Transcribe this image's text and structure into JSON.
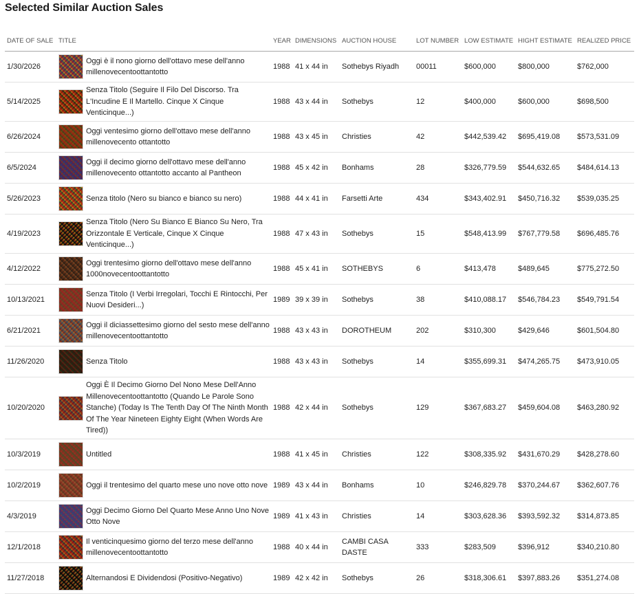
{
  "page": {
    "title": "Selected Similar Auction Sales"
  },
  "table": {
    "headers": {
      "date": "DATE OF SALE",
      "title": "TITLE",
      "year": "YEAR",
      "dimensions": "DIMENSIONS",
      "house": "AUCTION HOUSE",
      "lot": "LOT NUMBER",
      "low": "LOW ESTIMATE",
      "high": "HIGHT ESTIMATE",
      "realized": "REALIZED PRICE"
    },
    "rows": [
      {
        "date": "1/30/2026",
        "title": "Oggi è il nono giorno dell'ottavo mese dell'anno millenovecentoottantotto",
        "year": "1988",
        "dimensions": "41 x 44 in",
        "house": "Sothebys Riyadh",
        "lot": "00011",
        "low": "$600,000",
        "high": "$800,000",
        "realized": "$762,000",
        "thumb_colors": [
          "#b0567d",
          "#5b8fb3",
          "#d6b25a"
        ]
      },
      {
        "date": "5/14/2025",
        "title": "Senza Titolo (Seguire Il Filo Del Discorso. Tra L'Incudine E Il Martello. Cinque X Cinque Venticinque...)",
        "year": "1988",
        "dimensions": "43 x 44 in",
        "house": "Sothebys",
        "lot": "12",
        "low": "$400,000",
        "high": "$600,000",
        "realized": "$698,500",
        "thumb_colors": [
          "#c04a3a",
          "#4e7a4a",
          "#d9a54a"
        ]
      },
      {
        "date": "6/26/2024",
        "title": "Oggi ventesimo giorno dell'ottavo mese dell'anno millenovecento ottantotto",
        "year": "1988",
        "dimensions": "43 x 45 in",
        "house": "Christies",
        "lot": "42",
        "low": "$442,539.42",
        "high": "$695,419.08",
        "realized": "$573,531.09",
        "thumb_colors": [
          "#b8863c",
          "#6a9a5e",
          "#c45a4a"
        ]
      },
      {
        "date": "6/5/2024",
        "title": "Oggi il decimo giorno dell'ottavo mese dell'anno millenovecento ottantotto accanto al Pantheon",
        "year": "1988",
        "dimensions": "45 x 42 in",
        "house": "Bonhams",
        "lot": "28",
        "low": "$326,779.59",
        "high": "$544,632.65",
        "realized": "$484,614.13",
        "thumb_colors": [
          "#9a5a8a",
          "#c77a5a",
          "#6a7ab0"
        ]
      },
      {
        "date": "5/26/2023",
        "title": "Senza titolo (Nero su bianco e bianco su nero)",
        "year": "1988",
        "dimensions": "44 x 41 in",
        "house": "Farsetti Arte",
        "lot": "434",
        "low": "$343,402.91",
        "high": "$450,716.32",
        "realized": "$539,035.25",
        "thumb_colors": [
          "#c8504a",
          "#5a9a8a",
          "#d8b44a"
        ]
      },
      {
        "date": "4/19/2023",
        "title": "Senza Titolo (Nero Su Bianco E Bianco Su Nero, Tra Orizzontale E Verticale, Cinque X Cinque Venticinque...)",
        "year": "1988",
        "dimensions": "47 x 43 in",
        "house": "Sothebys",
        "lot": "15",
        "low": "$548,413.99",
        "high": "$767,779.58",
        "realized": "$696,485.76",
        "thumb_colors": [
          "#3a3a3a",
          "#b84a3a",
          "#c8a84a"
        ]
      },
      {
        "date": "4/12/2022",
        "title": "Oggi trentesimo giorno dell'ottavo mese dell'anno 1000novecentoottantotto",
        "year": "1988",
        "dimensions": "45 x 41 in",
        "house": "SOTHEBYS",
        "lot": "6",
        "low": "$413,478",
        "high": "$489,645",
        "realized": "$775,272.50",
        "thumb_colors": [
          "#9a6a4a",
          "#c89a6a",
          "#6a5a4a"
        ]
      },
      {
        "date": "10/13/2021",
        "title": "Senza Titolo (I Verbi Irregolari, Tocchi E Rintocchi, Per Nuovi Desideri...)",
        "year": "1989",
        "dimensions": "39 x 39 in",
        "house": "Sothebys",
        "lot": "38",
        "low": "$410,088.17",
        "high": "$546,784.23",
        "realized": "$549,791.54",
        "thumb_colors": [
          "#b87a5a",
          "#8a9a6a",
          "#c45a5a"
        ]
      },
      {
        "date": "6/21/2021",
        "title": "Oggi il diciassettesimo giorno del sesto mese dell'anno millenovecentoottantotto",
        "year": "1988",
        "dimensions": "43 x 43 in",
        "house": "DOROTHEUM",
        "lot": "202",
        "low": "$310,300",
        "high": "$429,646",
        "realized": "$601,504.80",
        "thumb_colors": [
          "#c89a6a",
          "#b85a4a",
          "#7a8aa0"
        ]
      },
      {
        "date": "11/26/2020",
        "title": "Senza Titolo",
        "year": "1988",
        "dimensions": "43 x 43 in",
        "house": "Sothebys",
        "lot": "14",
        "low": "$355,699.31",
        "high": "$474,265.75",
        "realized": "$473,910.05",
        "thumb_colors": [
          "#7a4a3a",
          "#b86a4a",
          "#5a6a4a"
        ]
      },
      {
        "date": "10/20/2020",
        "title": "Oggi È Il Decimo Giorno Del Nono Mese Dell'Anno Millenovecentoottantotto (Quando Le Parole Sono Stanche) (Today Is The Tenth Day Of The Ninth Month Of The Year Nineteen Eighty Eight (When Words Are Tired))",
        "year": "1988",
        "dimensions": "42 x 44 in",
        "house": "Sothebys",
        "lot": "129",
        "low": "$367,683.27",
        "high": "$459,604.08",
        "realized": "$463,280.92",
        "thumb_colors": [
          "#b8504a",
          "#6a7ab0",
          "#c8a05a"
        ]
      },
      {
        "date": "10/3/2019",
        "title": "Untitled",
        "year": "1988",
        "dimensions": "41 x 45 in",
        "house": "Christies",
        "lot": "122",
        "low": "$308,335.92",
        "high": "$431,670.29",
        "realized": "$428,278.60",
        "thumb_colors": [
          "#a87a5a",
          "#7a9a6a",
          "#c86a5a"
        ]
      },
      {
        "date": "10/2/2019",
        "title": "Oggi il trentesimo del quarto mese uno nove otto nove",
        "year": "1989",
        "dimensions": "43 x 44 in",
        "house": "Bonhams",
        "lot": "10",
        "low": "$246,829.78",
        "high": "$370,244.67",
        "realized": "$362,607.76",
        "thumb_colors": [
          "#c0906a",
          "#8a7a5a",
          "#b86a5a"
        ]
      },
      {
        "date": "4/3/2019",
        "title": "Oggi Decimo Giorno Del Quarto Mese Anno Uno Nove Otto Nove",
        "year": "1989",
        "dimensions": "41 x 43 in",
        "house": "Christies",
        "lot": "14",
        "low": "$303,628.36",
        "high": "$393,592.32",
        "realized": "$314,873.85",
        "thumb_colors": [
          "#9a6aa0",
          "#c87a7a",
          "#6a8ab0"
        ]
      },
      {
        "date": "12/1/2018",
        "title": "Il venticinquesimo giorno del terzo mese dell'anno millenovecentoottantotto",
        "year": "1988",
        "dimensions": "40 x 44 in",
        "house": "CAMBI CASA DASTE",
        "lot": "333",
        "low": "$283,509",
        "high": "$396,912",
        "realized": "$340,210.80",
        "thumb_colors": [
          "#c04a4a",
          "#5a7a9a",
          "#d0a04a"
        ]
      },
      {
        "date": "11/27/2018",
        "title": "Alternandosi E Dividendosi (Positivo-Negativo)",
        "year": "1989",
        "dimensions": "42 x 42 in",
        "house": "Sothebys",
        "lot": "26",
        "low": "$318,306.61",
        "high": "$397,883.26",
        "realized": "$351,274.08",
        "thumb_colors": [
          "#2a2a2a",
          "#c85a3a",
          "#b0a05a"
        ]
      }
    ]
  }
}
